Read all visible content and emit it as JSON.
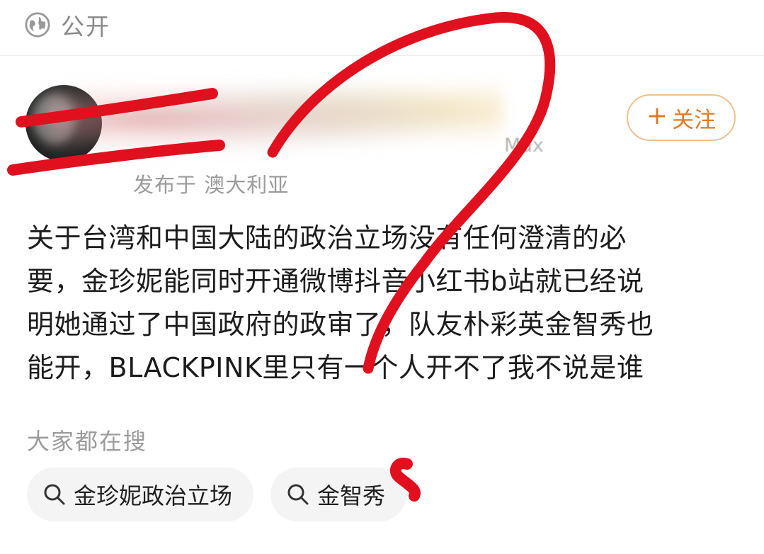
{
  "header": {
    "visibility_label": "公开",
    "icon": "globe-icon"
  },
  "author": {
    "device_suffix": "Max",
    "location": "发布于 澳大利亚",
    "follow_label": "关注",
    "follow_icon": "plus-icon",
    "accent_color": "#e07a22"
  },
  "post": {
    "lines": [
      "关于台湾和中国大陆的政治立场没有任何澄清的必",
      "要，金珍妮能同时开通微博抖音小红书b站就已经说",
      "明她通过了中国政府的政审了，队友朴彩英金智秀也",
      "能开，BLACKPINK里只有一个人开不了我不说是谁"
    ]
  },
  "trending": {
    "title": "大家都在搜",
    "chips": [
      {
        "label": "金珍妮政治立场",
        "icon": "search-icon"
      },
      {
        "label": "金智秀",
        "icon": "search-icon"
      }
    ]
  },
  "annotation_color": "#e0101e"
}
